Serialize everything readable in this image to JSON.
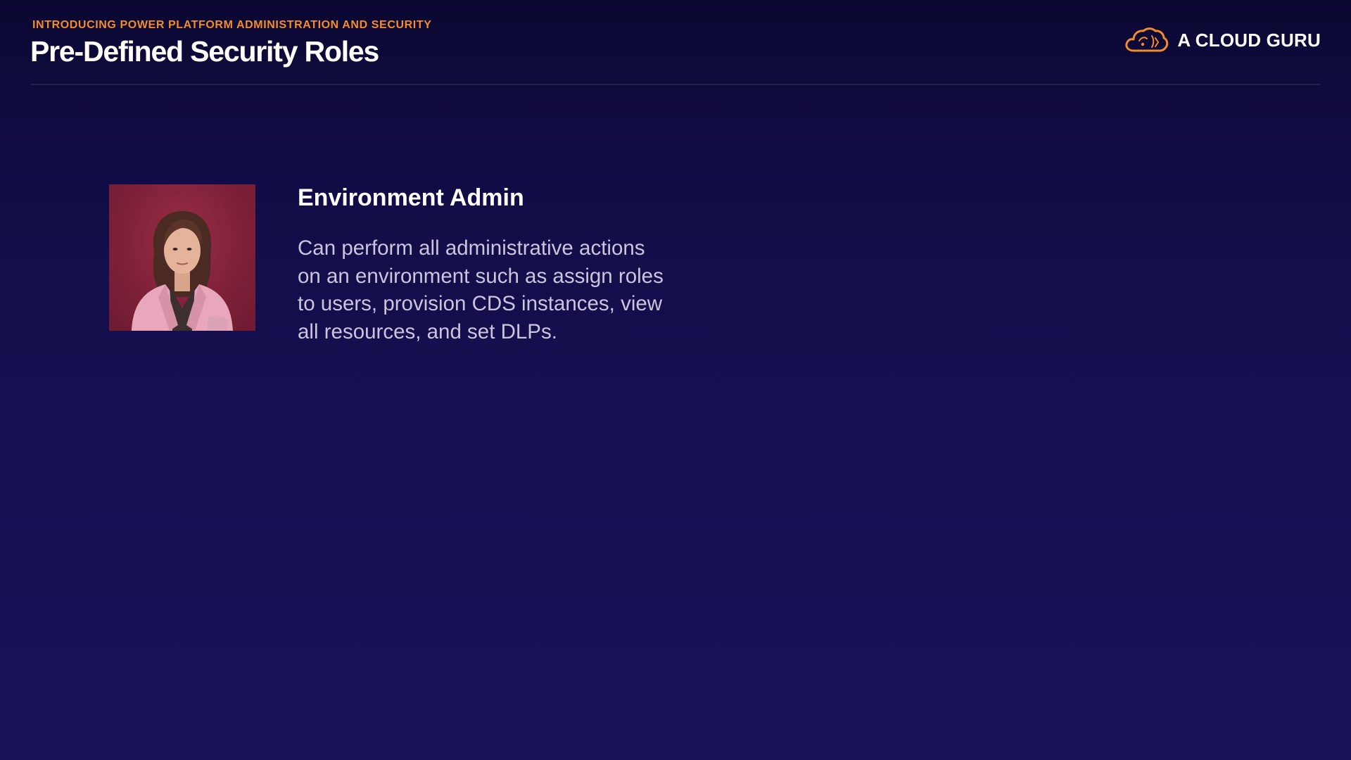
{
  "header": {
    "subtitle": "INTRODUCING POWER PLATFORM ADMINISTRATION AND SECURITY",
    "title": "Pre-Defined Security Roles"
  },
  "brand": {
    "name": "A CLOUD GURU",
    "icon": "cloud-icon"
  },
  "role": {
    "title": "Environment Admin",
    "description": "Can perform all administrative actions on an environment such as assign roles to users, provision CDS instances, view all resources, and set DLPs.",
    "image": "portrait-photo"
  },
  "colors": {
    "accent": "#f28b2b",
    "background_top": "#0b0832",
    "background_bottom": "#1a1257",
    "text_primary": "#ffffff",
    "text_secondary": "#c9c6dc",
    "photo_background": "#7d2038"
  }
}
